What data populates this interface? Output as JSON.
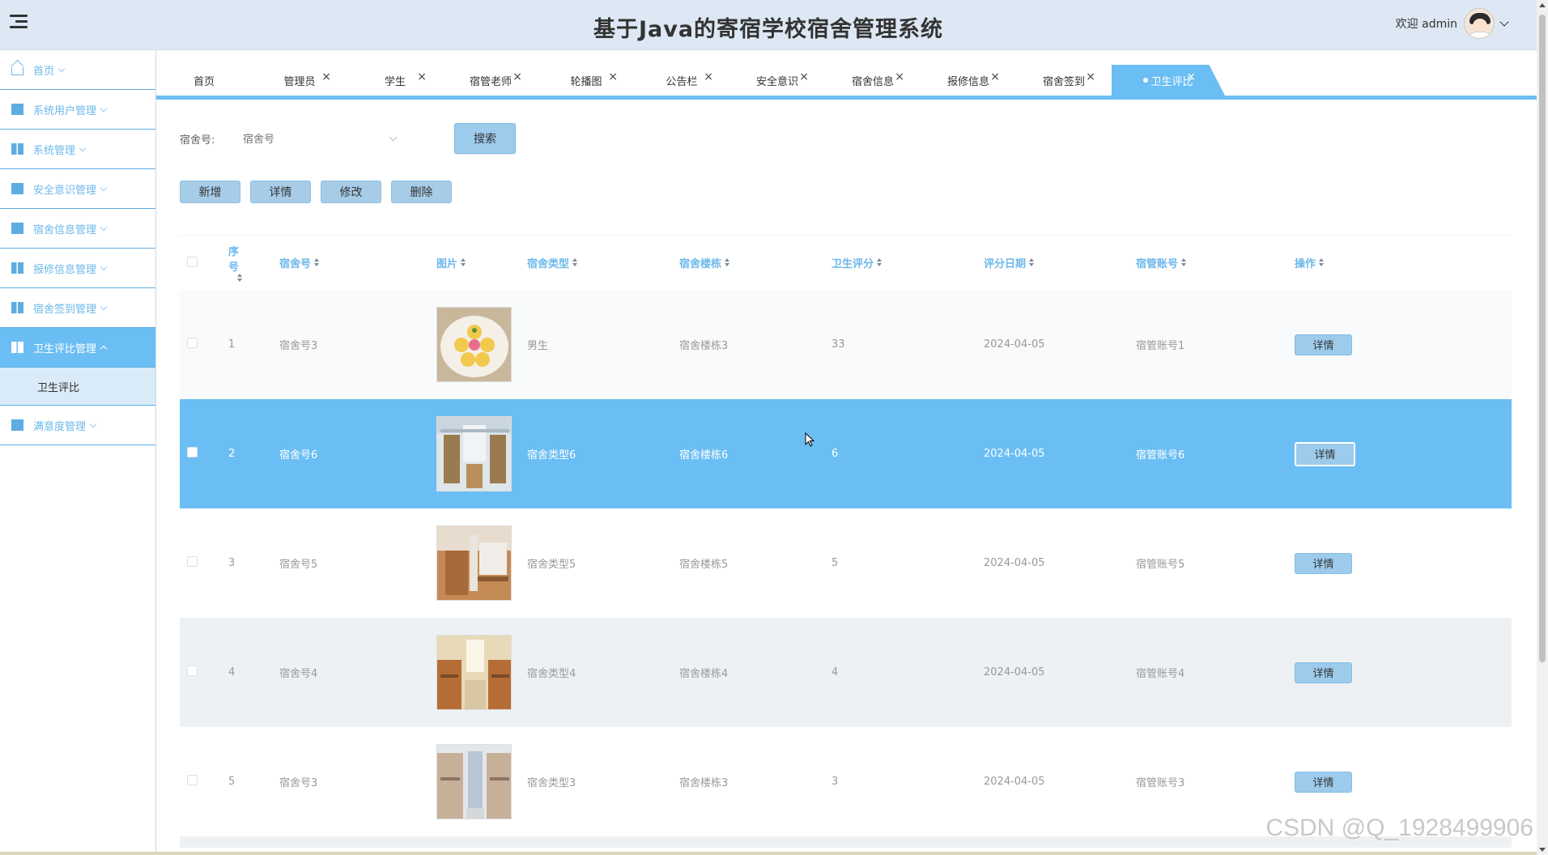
{
  "header": {
    "title": "基于Java的寄宿学校宿舍管理系统",
    "welcome": "欢迎 admin"
  },
  "sidebar": {
    "items": [
      {
        "label": "首页",
        "icon": "home-icon"
      },
      {
        "label": "系统用户管理",
        "icon": "users-icon"
      },
      {
        "label": "系统管理",
        "icon": "settings-icon"
      },
      {
        "label": "安全意识管理",
        "icon": "shield-icon"
      },
      {
        "label": "宿舍信息管理",
        "icon": "building-icon"
      },
      {
        "label": "报修信息管理",
        "icon": "wrench-icon"
      },
      {
        "label": "宿舍签到管理",
        "icon": "checkin-icon"
      },
      {
        "label": "卫生评比管理",
        "icon": "grid-icon"
      },
      {
        "label": "满意度管理",
        "icon": "folder-icon"
      }
    ],
    "submenu": [
      "卫生评比"
    ]
  },
  "tabs": [
    "首页",
    "管理员",
    "学生",
    "宿管老师",
    "轮播图",
    "公告栏",
    "安全意识",
    "宿舍信息",
    "报修信息",
    "宿舍签到",
    "卫生评比"
  ],
  "search": {
    "label": "宿舍号:",
    "placeholder": "宿舍号",
    "button": "搜索"
  },
  "actions": {
    "add": "新增",
    "detail": "详情",
    "edit": "修改",
    "delete": "删除"
  },
  "table": {
    "columns": [
      "序号",
      "宿舍号",
      "图片",
      "宿舍类型",
      "宿舍楼栋",
      "卫生评分",
      "评分日期",
      "宿管账号",
      "操作"
    ],
    "rows": [
      {
        "idx": "1",
        "dorm": "宿舍号3",
        "type": "男生",
        "building": "宿舍楼栋3",
        "score": "33",
        "date": "2024-04-05",
        "account": "宿管账号1",
        "op": "详情"
      },
      {
        "idx": "2",
        "dorm": "宿舍号6",
        "type": "宿舍类型6",
        "building": "宿舍楼栋6",
        "score": "6",
        "date": "2024-04-05",
        "account": "宿管账号6",
        "op": "详情"
      },
      {
        "idx": "3",
        "dorm": "宿舍号5",
        "type": "宿舍类型5",
        "building": "宿舍楼栋5",
        "score": "5",
        "date": "2024-04-05",
        "account": "宿管账号5",
        "op": "详情"
      },
      {
        "idx": "4",
        "dorm": "宿舍号4",
        "type": "宿舍类型4",
        "building": "宿舍楼栋4",
        "score": "4",
        "date": "2024-04-05",
        "account": "宿管账号4",
        "op": "详情"
      },
      {
        "idx": "5",
        "dorm": "宿舍号3",
        "type": "宿舍类型3",
        "building": "宿舍楼栋3",
        "score": "3",
        "date": "2024-04-05",
        "account": "宿管账号3",
        "op": "详情"
      }
    ]
  },
  "watermark": "CSDN @Q_1928499906",
  "colors": {
    "accent": "#6bbef3",
    "header_bg": "#dde8f4",
    "button_bg": "#9ccbec"
  }
}
